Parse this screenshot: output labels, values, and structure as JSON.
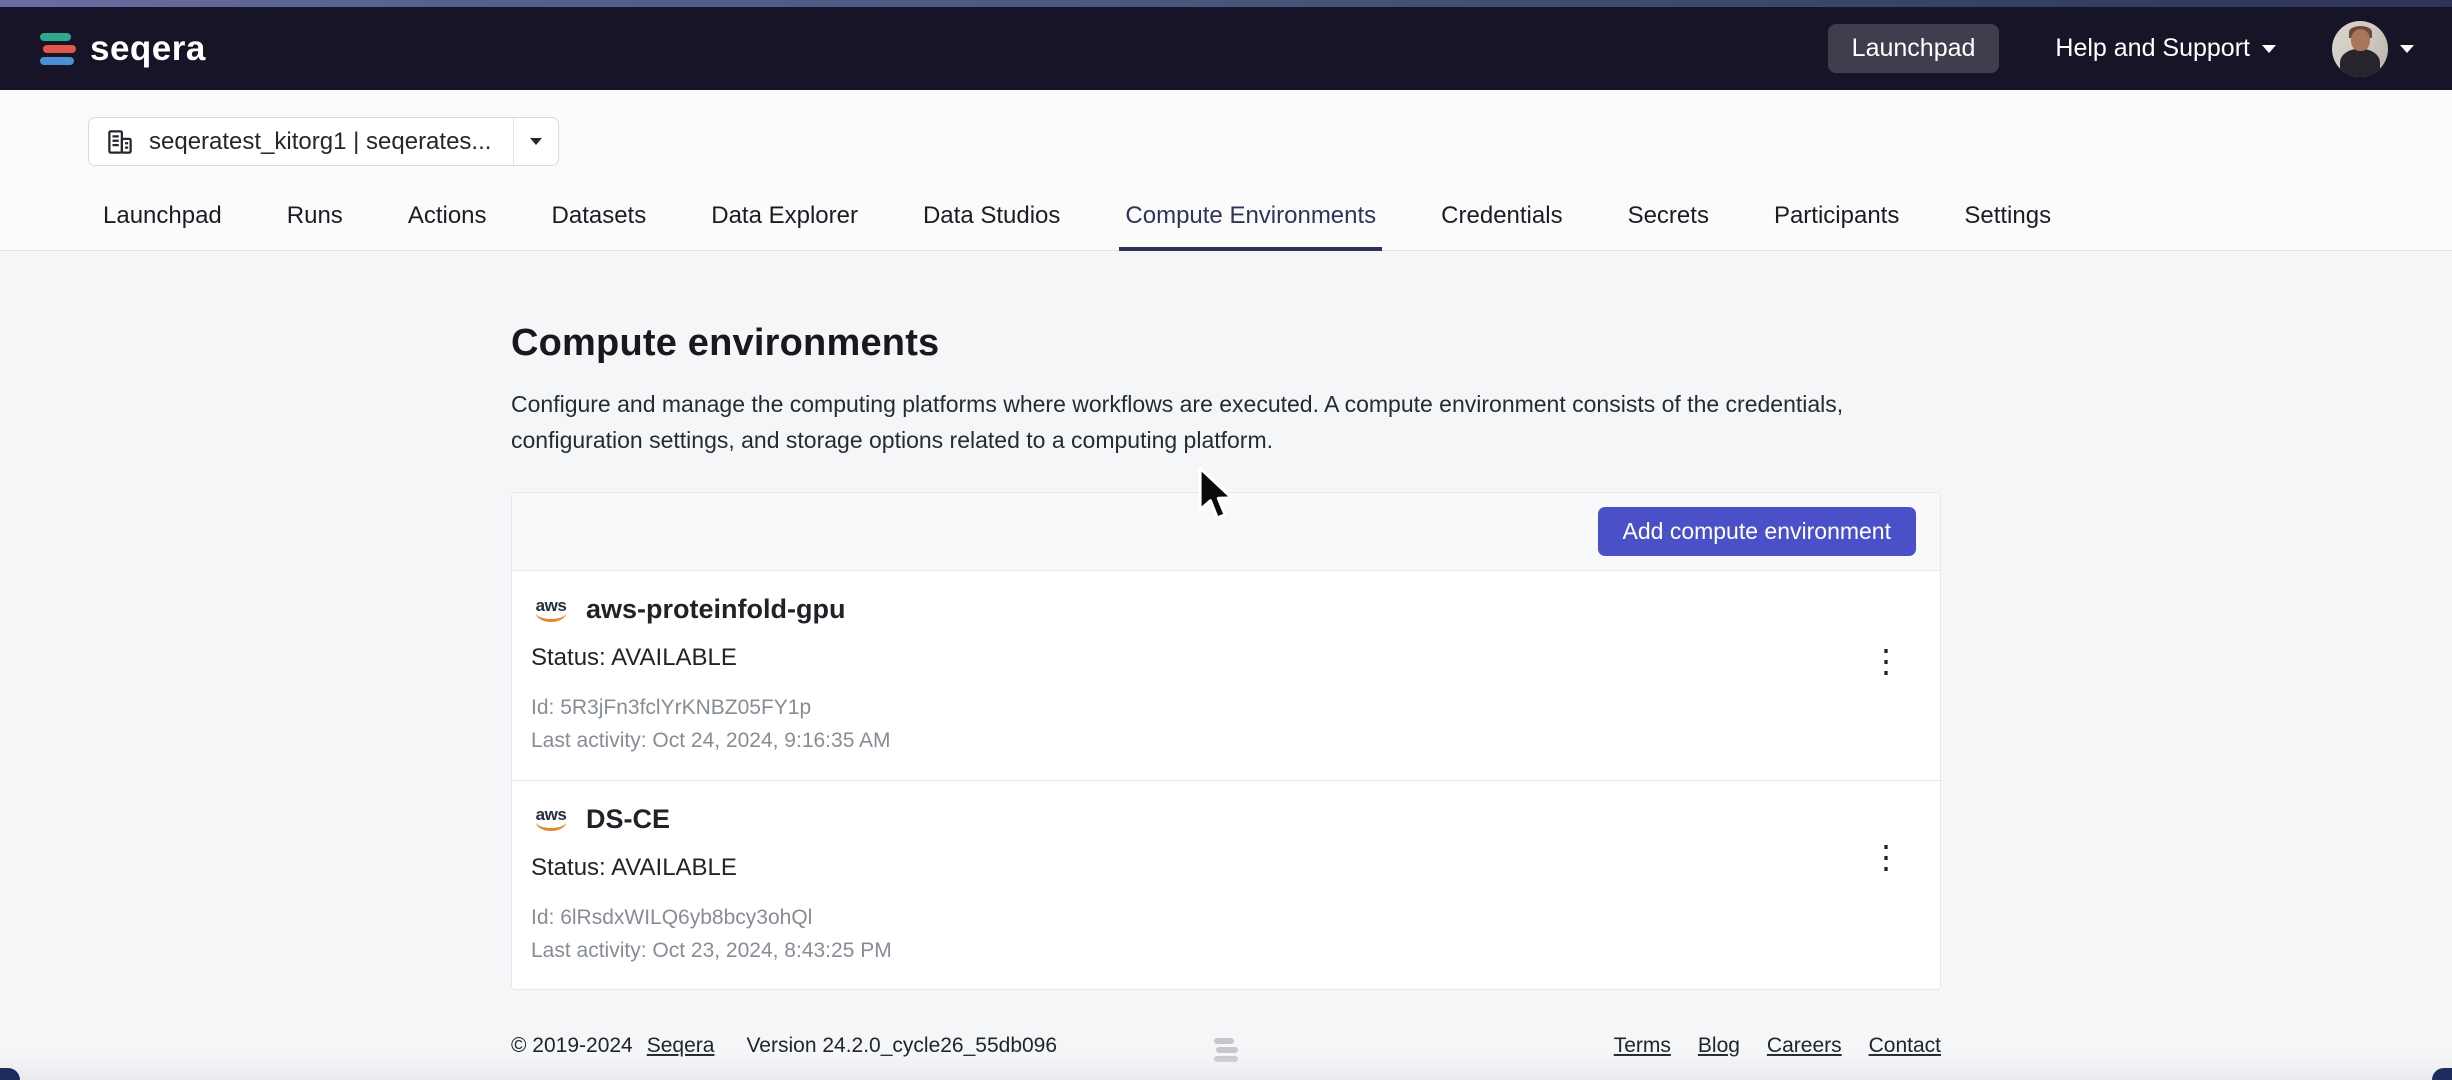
{
  "colors": {
    "accent": "#4a51c8",
    "navbar_bg": "#181427",
    "active_tab_underline": "#2d3254",
    "aws_orange": "#e8862c"
  },
  "navbar": {
    "brand": "seqera",
    "launchpad": "Launchpad",
    "help": "Help and Support"
  },
  "workspace": {
    "selected": "seqeratest_kitorg1 | seqerates..."
  },
  "tabs": [
    {
      "label": "Launchpad"
    },
    {
      "label": "Runs"
    },
    {
      "label": "Actions"
    },
    {
      "label": "Datasets"
    },
    {
      "label": "Data Explorer"
    },
    {
      "label": "Data Studios"
    },
    {
      "label": "Compute Environments",
      "active": true
    },
    {
      "label": "Credentials"
    },
    {
      "label": "Secrets"
    },
    {
      "label": "Participants"
    },
    {
      "label": "Settings"
    }
  ],
  "page": {
    "title": "Compute environments",
    "description": "Configure and manage the computing platforms where workflows are executed. A compute environment consists of the credentials, configuration settings, and storage options related to a computing platform."
  },
  "panel": {
    "add_button": "Add compute environment"
  },
  "environments": [
    {
      "provider": "aws",
      "name": "aws-proteinfold-gpu",
      "status_label": "Status:",
      "status": "AVAILABLE",
      "id_label": "Id:",
      "id": "5R3jFn3fclYrKNBZ05FY1p",
      "activity_label": "Last activity:",
      "last_activity": "Oct 24, 2024, 9:16:35 AM"
    },
    {
      "provider": "aws",
      "name": "DS-CE",
      "status_label": "Status:",
      "status": "AVAILABLE",
      "id_label": "Id:",
      "id": "6lRsdxWILQ6yb8bcy3ohQl",
      "activity_label": "Last activity:",
      "last_activity": "Oct 23, 2024, 8:43:25 PM"
    }
  ],
  "footer": {
    "copyright": "© 2019-2024",
    "company": "Seqera",
    "version": "Version 24.2.0_cycle26_55db096",
    "links": [
      {
        "label": "Terms"
      },
      {
        "label": "Blog"
      },
      {
        "label": "Careers"
      },
      {
        "label": "Contact"
      }
    ]
  }
}
